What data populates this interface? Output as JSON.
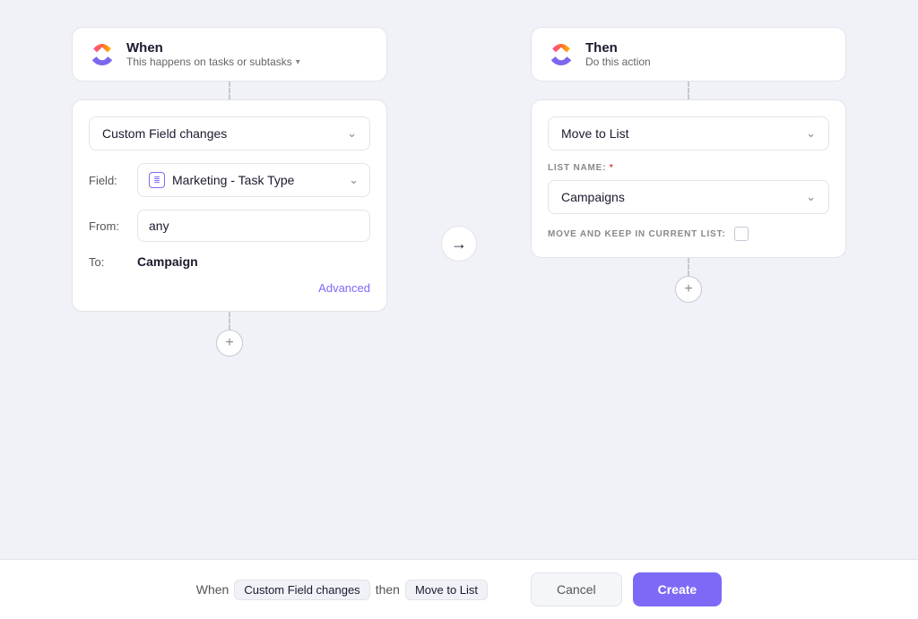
{
  "when_header": {
    "title": "When",
    "subtitle": "This happens on tasks or subtasks",
    "chevron": "▾"
  },
  "then_header": {
    "title": "Then",
    "subtitle": "Do this action"
  },
  "when_card": {
    "trigger_select": "Custom Field changes",
    "field_label": "Field:",
    "field_icon": "≣",
    "field_value": "Marketing - Task Type",
    "from_label": "From:",
    "from_value": "any",
    "to_label": "To:",
    "to_value": "Campaign",
    "advanced_link": "Advanced"
  },
  "then_card": {
    "action_select": "Move to List",
    "list_name_label": "LIST NAME:",
    "list_name_required": "*",
    "list_name_value": "Campaigns",
    "move_keep_label": "MOVE AND KEEP IN CURRENT LIST:"
  },
  "arrow": "→",
  "bottom_bar": {
    "when_text": "When",
    "trigger_badge": "Custom Field changes",
    "then_text": "then",
    "action_badge": "Move to List",
    "cancel_label": "Cancel",
    "create_label": "Create"
  }
}
